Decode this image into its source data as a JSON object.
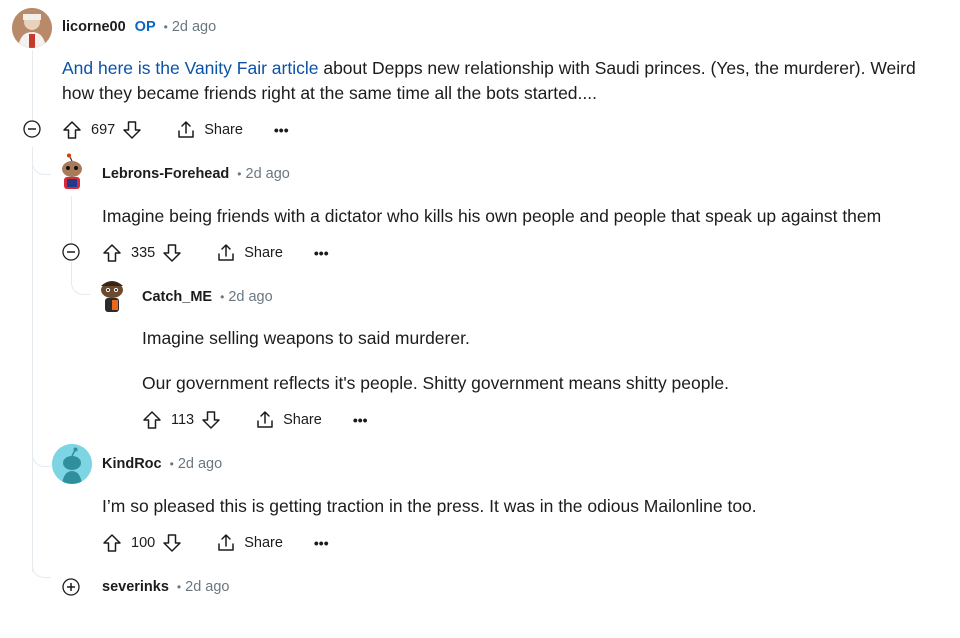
{
  "comments": [
    {
      "author": "licorne00",
      "op_badge": "OP",
      "time": "2d ago",
      "link_text": "And here is the Vanity Fair article",
      "body_rest": " about Depps new relationship with Saudi princes. (Yes, the murderer). Weird",
      "body_line2": "how they became friends right at the same time all the bots started....",
      "votes": "697",
      "share": "Share",
      "more": "•••"
    },
    {
      "author": "Lebrons-Forehead",
      "time": "2d ago",
      "body": "Imagine being friends with a dictator who kills his own people and people that speak up against them",
      "votes": "335",
      "share": "Share",
      "more": "•••"
    },
    {
      "author": "Catch_ME",
      "time": "2d ago",
      "body_p1": "Imagine selling weapons to said murderer.",
      "body_p2": "Our government reflects it's people. Shitty government means shitty people.",
      "votes": "113",
      "share": "Share",
      "more": "•••"
    },
    {
      "author": "KindRoc",
      "time": "2d ago",
      "body": "I’m so pleased this is getting traction in the press. It was in the odious Mailonline too.",
      "votes": "100",
      "share": "Share",
      "more": "•••"
    },
    {
      "author": "severinks",
      "time": "2d ago"
    }
  ],
  "colors": {
    "link": "#0a52a8",
    "op": "#0a66c2",
    "meta": "#6b7780",
    "thread": "#e5ebee"
  },
  "icons": [
    "upvote-icon",
    "downvote-icon",
    "share-icon",
    "more-icon",
    "collapse-icon",
    "expand-icon"
  ]
}
